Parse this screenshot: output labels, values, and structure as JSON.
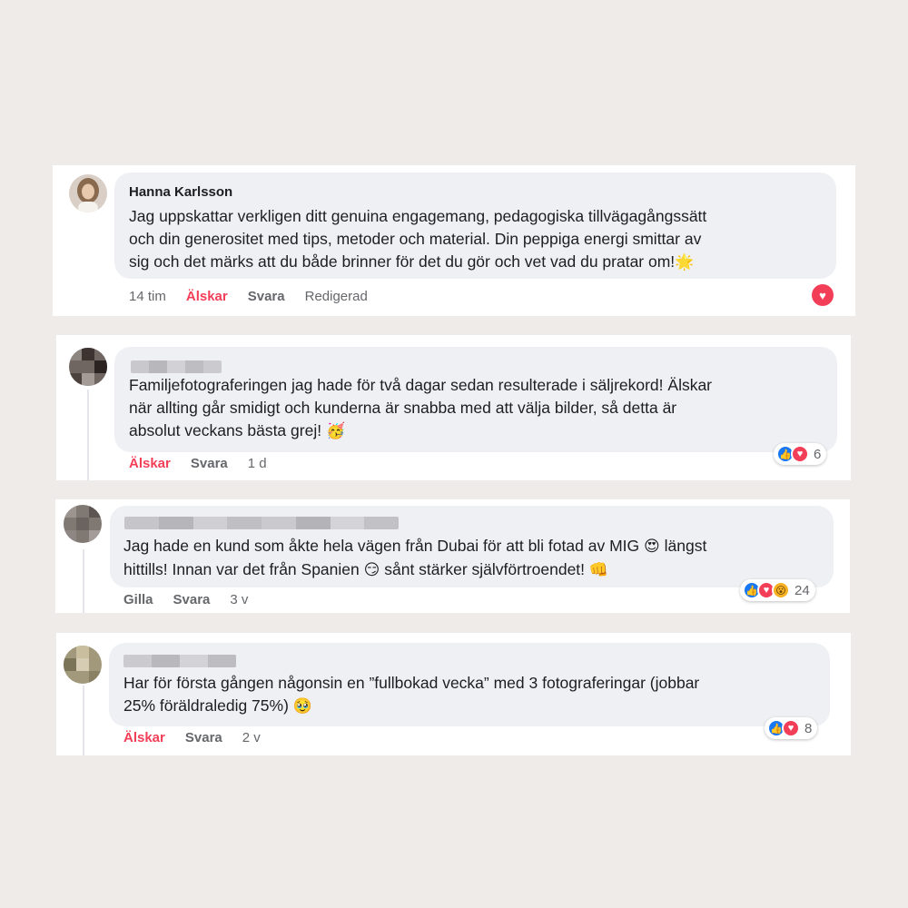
{
  "colors": {
    "love": "#f33e58",
    "like": "#1877f2",
    "bubble": "#eef0f3",
    "muted": "#65676b"
  },
  "comments": [
    {
      "author": "Hanna Karlsson",
      "lines": [
        "Jag uppskattar verkligen ditt genuina engagemang, pedagogiska tillvägagångssätt",
        "och din generositet med tips, metoder och material. Din peppiga energi smittar av",
        "sig och det märks att du både brinner för det du gör och vet vad du pratar om!"
      ],
      "emoji": "🌟",
      "time": "14 tim",
      "love_label": "Älskar",
      "reply_label": "Svara",
      "edited_label": "Redigerad",
      "reactions": [
        "heart-icon"
      ]
    },
    {
      "lines": [
        "Familjefotograferingen jag hade för två dagar sedan resulterade i säljrekord! Älskar",
        "när allting går smidigt och kunderna är snabba med att välja bilder, så detta är",
        "absolut veckans bästa grej!"
      ],
      "emoji": "🥳",
      "love_label": "Älskar",
      "reply_label": "Svara",
      "time": "1 d",
      "reactions": [
        "like-icon",
        "heart-icon"
      ],
      "reaction_count": "6"
    },
    {
      "lines": [
        "Jag hade en kund som åkte hela vägen från Dubai för att bli fotad av MIG",
        "hittills! Innan var det från Spanien",
        "sånt stärker självförtroendet!"
      ],
      "emoji_1": "😍",
      "line1_tail": "längst",
      "emoji_2": "😏",
      "emoji_3": "👊",
      "like_label": "Gilla",
      "reply_label": "Svara",
      "time": "3 v",
      "reactions": [
        "like-icon",
        "heart-icon",
        "wow-icon"
      ],
      "reaction_count": "24"
    },
    {
      "lines": [
        "Har för första gången någonsin en ”fullbokad vecka” med 3 fotograferingar (jobbar",
        "25% föräldraledig 75%)"
      ],
      "emoji": "🥹",
      "love_label": "Älskar",
      "reply_label": "Svara",
      "time": "2 v",
      "reactions": [
        "like-icon",
        "heart-icon"
      ],
      "reaction_count": "8"
    }
  ]
}
